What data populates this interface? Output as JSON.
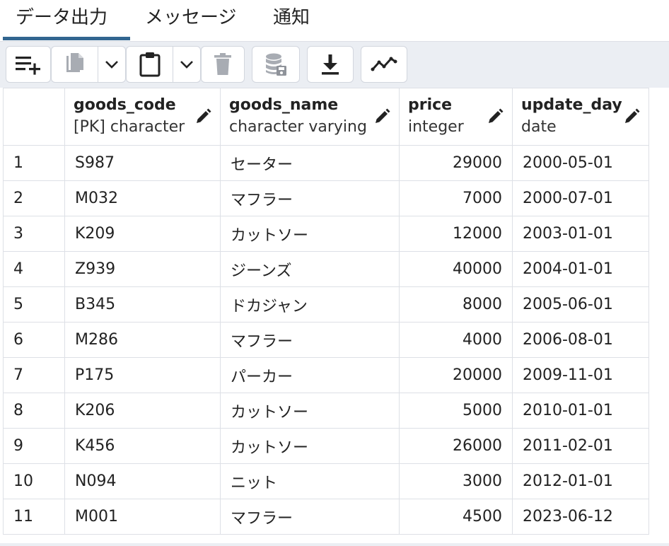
{
  "tabs": [
    {
      "label": "データ出力",
      "active": true
    },
    {
      "label": "メッセージ",
      "active": false
    },
    {
      "label": "通知",
      "active": false
    }
  ],
  "toolbar": {
    "buttons": [
      {
        "name": "add-row-button",
        "icon": "add-row-icon"
      },
      {
        "name": "copy-button",
        "icon": "copy-icon"
      },
      {
        "name": "copy-options-button",
        "icon": "chevron-down-icon"
      },
      {
        "name": "paste-button",
        "icon": "clipboard-icon"
      },
      {
        "name": "paste-options-button",
        "icon": "chevron-down-icon"
      },
      {
        "name": "delete-button",
        "icon": "trash-icon"
      },
      {
        "name": "save-data-button",
        "icon": "database-save-icon"
      },
      {
        "name": "download-button",
        "icon": "download-icon"
      },
      {
        "name": "graph-visualiser-button",
        "icon": "line-chart-icon"
      }
    ]
  },
  "columns": [
    {
      "name": "",
      "type": ""
    },
    {
      "name": "goods_code",
      "type": "[PK] character"
    },
    {
      "name": "goods_name",
      "type": "character varying"
    },
    {
      "name": "price",
      "type": "integer"
    },
    {
      "name": "update_day",
      "type": "date"
    }
  ],
  "rows": [
    [
      "1",
      "S987",
      "セーター",
      "29000",
      "2000-05-01"
    ],
    [
      "2",
      "M032",
      "マフラー",
      "7000",
      "2000-07-01"
    ],
    [
      "3",
      "K209",
      "カットソー",
      "12000",
      "2003-01-01"
    ],
    [
      "4",
      "Z939",
      "ジーンズ",
      "40000",
      "2004-01-01"
    ],
    [
      "5",
      "B345",
      "ドカジャン",
      "8000",
      "2005-06-01"
    ],
    [
      "6",
      "M286",
      "マフラー",
      "4000",
      "2006-08-01"
    ],
    [
      "7",
      "P175",
      "パーカー",
      "20000",
      "2009-11-01"
    ],
    [
      "8",
      "K206",
      "カットソー",
      "5000",
      "2010-01-01"
    ],
    [
      "9",
      "K456",
      "カットソー",
      "26000",
      "2011-02-01"
    ],
    [
      "10",
      "N094",
      "ニット",
      "3000",
      "2012-01-01"
    ],
    [
      "11",
      "M001",
      "マフラー",
      "4500",
      "2023-06-12"
    ]
  ],
  "colors": {
    "accent": "#326690",
    "toolbar_bg": "#ebeef3",
    "grid_border": "#dde0e6",
    "icon": "#222222",
    "icon_disabled": "#a8acb3"
  }
}
